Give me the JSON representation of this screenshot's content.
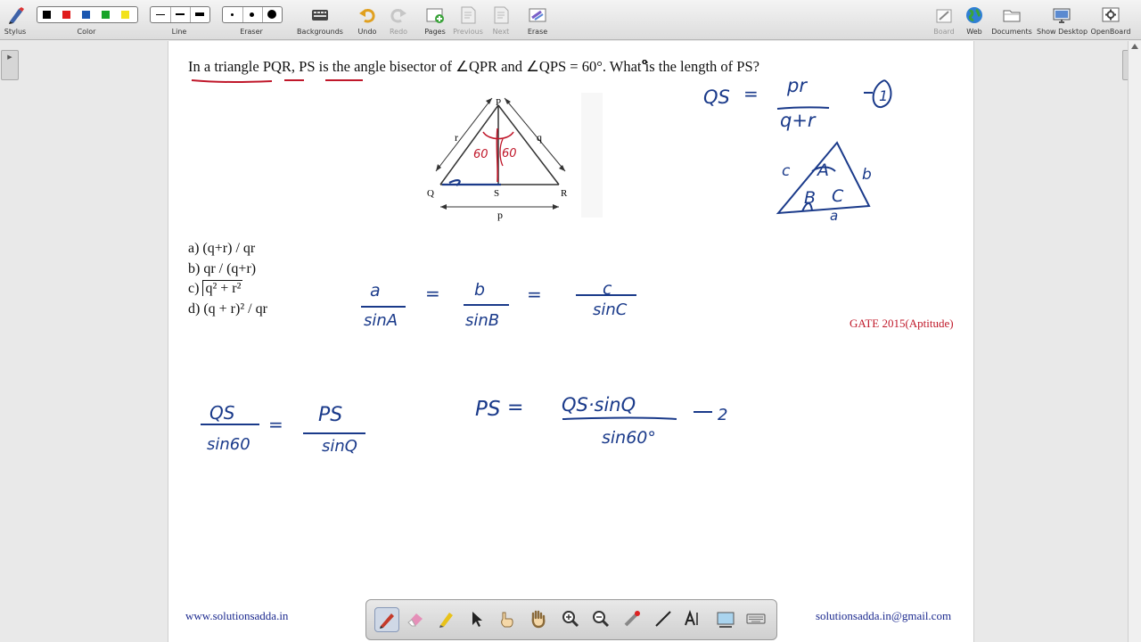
{
  "toolbar": {
    "stylus_label": "Stylus",
    "color_label": "Color",
    "line_label": "Line",
    "eraser_label": "Eraser",
    "backgrounds_label": "Backgrounds",
    "undo_label": "Undo",
    "redo_label": "Redo",
    "pages_label": "Pages",
    "previous_label": "Previous",
    "next_label": "Next",
    "erase_label": "Erase",
    "board_label": "Board",
    "web_label": "Web",
    "documents_label": "Documents",
    "show_desktop_label": "Show Desktop",
    "openboard_label": "OpenBoard",
    "colors": [
      "#000000",
      "#e01b1b",
      "#1a56b0",
      "#18a329",
      "#f2e21c"
    ]
  },
  "question": {
    "text": "In a triangle PQR, PS is the angle bisector of ∠QPR and ∠QPS = 60°. What is the  length of PS?"
  },
  "figure": {
    "vertex_p": "P",
    "vertex_q": "Q",
    "vertex_r": "R",
    "point_s": "S",
    "side_r": "r",
    "side_q": "q",
    "side_p": "p"
  },
  "options": {
    "a": "a) (q+r) / qr",
    "b": "b) qr / (q+r)",
    "c_prefix": "c) ",
    "c_expr": "q² + r²",
    "d": "d) (q + r)² / qr"
  },
  "source_tag": "GATE 2015(Aptitude)",
  "footer": {
    "website": "www.solutionsadda.in",
    "email": "solutionsadda.in@gmail.com"
  },
  "annotations": {
    "qs_formula_lhs": "QS",
    "qs_formula_eq": "=",
    "qs_formula_num": "pr",
    "qs_formula_den": "q+r",
    "qs_formula_tag": "1",
    "small_triangle_labels": [
      "c",
      "A",
      "b",
      "B",
      "C",
      "a"
    ],
    "angle_left": "60",
    "angle_right": "60",
    "sine_rule_a": "a",
    "sine_rule_sinA": "sinA",
    "sine_rule_b": "b",
    "sine_rule_sinB": "sinB",
    "sine_rule_c": "c",
    "sine_rule_sinC": "sinC",
    "eq_qs": "QS",
    "eq_sin60": "sin60",
    "eq_ps": "PS",
    "eq_sinQ": "sinQ",
    "ps_lhs": "PS",
    "ps_eq": "=",
    "ps_num": "QS·sinQ",
    "ps_den": "sin60°",
    "ps_tag": "2"
  }
}
